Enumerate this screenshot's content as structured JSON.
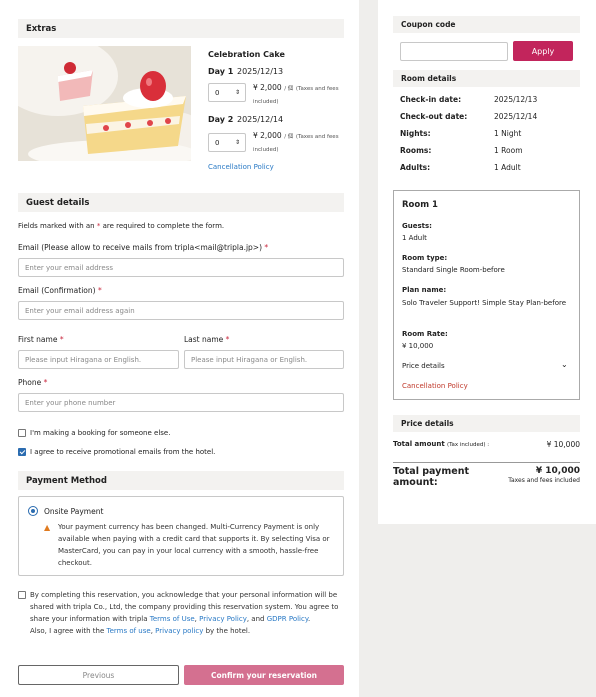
{
  "extras": {
    "heading": "Extras",
    "item_name": "Celebration Cake",
    "day1_label": "Day 1",
    "day1_date": "2025/12/13",
    "day1_qty": "0",
    "day1_price": "¥ 2,000",
    "day1_unit": "/ 個",
    "day1_tax": "(Taxes and fees included)",
    "day2_label": "Day 2",
    "day2_date": "2025/12/14",
    "day2_qty": "0",
    "day2_price": "¥ 2,000",
    "day2_unit": "/ 個",
    "day2_tax": "(Taxes and fees included)",
    "cancellation_policy": "Cancellation Policy"
  },
  "guest": {
    "heading": "Guest details",
    "required_note_pre": "Fields marked with an",
    "required_note_star": "*",
    "required_note_post": "are required to complete the form.",
    "email_label": "Email (Please allow to receive mails from tripla<mail@tripla.jp>)",
    "email_placeholder": "Enter your email address",
    "email_confirm_label": "Email (Confirmation)",
    "email_confirm_placeholder": "Enter your email address again",
    "first_name_label": "First name",
    "first_name_placeholder": "Please input Hiragana or English.",
    "last_name_label": "Last name",
    "last_name_placeholder": "Please input Hiragana or English.",
    "phone_label": "Phone",
    "phone_placeholder": "Enter your phone number",
    "someone_else": "I'm making a booking for someone else.",
    "promo_emails": "I agree to receive promotional emails from the hotel.",
    "star": "*"
  },
  "payment": {
    "heading": "Payment Method",
    "option": "Onsite Payment",
    "warning": "Your payment currency has been changed. Multi-Currency Payment is only available when paying with a credit card that supports it. By selecting Visa or MasterCard, you can pay in your local currency with a smooth, hassle-free checkout."
  },
  "consent": {
    "text1": "By completing this reservation, you acknowledge that your personal information will be shared with tripla Co., Ltd, the company providing this reservation system. You agree to share your information with tripla",
    "terms": "Terms of Use",
    "comma": ",",
    "privacy": "Privacy Policy",
    "and": ", and",
    "gdpr": "GDPR Policy",
    "period": ".",
    "text2": "Also, I agree with the",
    "terms2": "Terms of use",
    "comma2": ",",
    "privacy2": "Privacy policy",
    "text3": "by the hotel."
  },
  "buttons": {
    "previous": "Previous",
    "confirm": "Confirm your reservation",
    "apply": "Apply"
  },
  "coupon": {
    "heading": "Coupon code"
  },
  "room_details": {
    "heading": "Room details",
    "checkin_label": "Check-in date:",
    "checkin_value": "2025/12/13",
    "checkout_label": "Check-out date:",
    "checkout_value": "2025/12/14",
    "nights_label": "Nights:",
    "nights_value": "1 Night",
    "rooms_label": "Rooms:",
    "rooms_value": "1 Room",
    "adults_label": "Adults:",
    "adults_value": "1 Adult"
  },
  "room1": {
    "title": "Room 1",
    "guests_label": "Guests:",
    "guests_value": "1 Adult",
    "type_label": "Room type:",
    "type_value": "Standard Single Room-before",
    "plan_label": "Plan name:",
    "plan_value": "Solo Traveler Support! Simple Stay Plan-before",
    "rate_label": "Room Rate:",
    "rate_value": "¥ 10,000",
    "price_details": "Price details",
    "cancellation": "Cancellation Policy"
  },
  "price": {
    "heading": "Price details",
    "total_label": "Total amount",
    "total_note": "(Tax included) :",
    "total_value": "¥ 10,000",
    "payment_label": "Total payment amount:",
    "payment_value": "¥ 10,000",
    "payment_note": "Taxes and fees included"
  },
  "colors": {
    "accent": "#c2255c",
    "confirm_button": "#d47090",
    "link": "#2979c5",
    "required": "#c9283e",
    "cancellation": "#c0392b"
  }
}
